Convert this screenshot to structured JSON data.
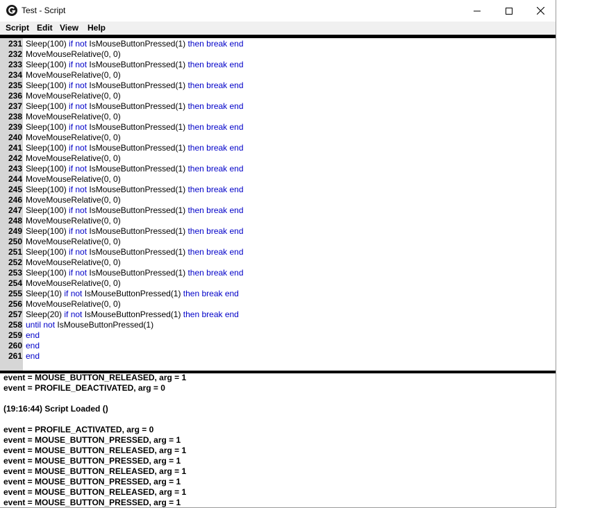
{
  "window": {
    "title": "Test - Script"
  },
  "menu": [
    {
      "label": "Script",
      "name": "menu-script"
    },
    {
      "label": "Edit",
      "name": "menu-edit"
    },
    {
      "label": "View",
      "name": "menu-view"
    },
    {
      "label": "Help",
      "name": "menu-help"
    }
  ],
  "editor": {
    "lines": [
      {
        "n": "231",
        "tokens": [
          [
            "t",
            "Sleep(100) "
          ],
          [
            "k",
            "if not"
          ],
          [
            "t",
            " IsMouseButtonPressed(1) "
          ],
          [
            "k",
            "then break end"
          ]
        ]
      },
      {
        "n": "232",
        "tokens": [
          [
            "t",
            "MoveMouseRelative(0, 0)"
          ]
        ]
      },
      {
        "n": "233",
        "tokens": [
          [
            "t",
            "Sleep(100) "
          ],
          [
            "k",
            "if not"
          ],
          [
            "t",
            " IsMouseButtonPressed(1) "
          ],
          [
            "k",
            "then break end"
          ]
        ]
      },
      {
        "n": "234",
        "tokens": [
          [
            "t",
            "MoveMouseRelative(0, 0)"
          ]
        ]
      },
      {
        "n": "235",
        "tokens": [
          [
            "t",
            "Sleep(100) "
          ],
          [
            "k",
            "if not"
          ],
          [
            "t",
            " IsMouseButtonPressed(1) "
          ],
          [
            "k",
            "then break end"
          ]
        ]
      },
      {
        "n": "236",
        "tokens": [
          [
            "t",
            "MoveMouseRelative(0, 0)"
          ]
        ]
      },
      {
        "n": "237",
        "tokens": [
          [
            "t",
            "Sleep(100) "
          ],
          [
            "k",
            "if not"
          ],
          [
            "t",
            " IsMouseButtonPressed(1) "
          ],
          [
            "k",
            "then break end"
          ]
        ]
      },
      {
        "n": "238",
        "tokens": [
          [
            "t",
            "MoveMouseRelative(0, 0)"
          ]
        ]
      },
      {
        "n": "239",
        "tokens": [
          [
            "t",
            "Sleep(100) "
          ],
          [
            "k",
            "if not"
          ],
          [
            "t",
            " IsMouseButtonPressed(1) "
          ],
          [
            "k",
            "then break end"
          ]
        ]
      },
      {
        "n": "240",
        "tokens": [
          [
            "t",
            "MoveMouseRelative(0, 0)"
          ]
        ]
      },
      {
        "n": "241",
        "tokens": [
          [
            "t",
            "Sleep(100) "
          ],
          [
            "k",
            "if not"
          ],
          [
            "t",
            " IsMouseButtonPressed(1) "
          ],
          [
            "k",
            "then break end"
          ]
        ]
      },
      {
        "n": "242",
        "tokens": [
          [
            "t",
            "MoveMouseRelative(0, 0)"
          ]
        ]
      },
      {
        "n": "243",
        "tokens": [
          [
            "t",
            "Sleep(100) "
          ],
          [
            "k",
            "if not"
          ],
          [
            "t",
            " IsMouseButtonPressed(1) "
          ],
          [
            "k",
            "then break end"
          ]
        ]
      },
      {
        "n": "244",
        "tokens": [
          [
            "t",
            "MoveMouseRelative(0, 0)"
          ]
        ]
      },
      {
        "n": "245",
        "tokens": [
          [
            "t",
            "Sleep(100) "
          ],
          [
            "k",
            "if not"
          ],
          [
            "t",
            " IsMouseButtonPressed(1) "
          ],
          [
            "k",
            "then break end"
          ]
        ]
      },
      {
        "n": "246",
        "tokens": [
          [
            "t",
            "MoveMouseRelative(0, 0)"
          ]
        ]
      },
      {
        "n": "247",
        "tokens": [
          [
            "t",
            "Sleep(100) "
          ],
          [
            "k",
            "if not"
          ],
          [
            "t",
            " IsMouseButtonPressed(1) "
          ],
          [
            "k",
            "then break end"
          ]
        ]
      },
      {
        "n": "248",
        "tokens": [
          [
            "t",
            "MoveMouseRelative(0, 0)"
          ]
        ]
      },
      {
        "n": "249",
        "tokens": [
          [
            "t",
            "Sleep(100) "
          ],
          [
            "k",
            "if not"
          ],
          [
            "t",
            " IsMouseButtonPressed(1) "
          ],
          [
            "k",
            "then break end"
          ]
        ]
      },
      {
        "n": "250",
        "tokens": [
          [
            "t",
            "MoveMouseRelative(0, 0)"
          ]
        ]
      },
      {
        "n": "251",
        "tokens": [
          [
            "t",
            "Sleep(100) "
          ],
          [
            "k",
            "if not"
          ],
          [
            "t",
            " IsMouseButtonPressed(1) "
          ],
          [
            "k",
            "then break end"
          ]
        ]
      },
      {
        "n": "252",
        "tokens": [
          [
            "t",
            "MoveMouseRelative(0, 0)"
          ]
        ]
      },
      {
        "n": "253",
        "tokens": [
          [
            "t",
            "Sleep(100) "
          ],
          [
            "k",
            "if not"
          ],
          [
            "t",
            " IsMouseButtonPressed(1) "
          ],
          [
            "k",
            "then break end"
          ]
        ]
      },
      {
        "n": "254",
        "tokens": [
          [
            "t",
            "MoveMouseRelative(0, 0)"
          ]
        ]
      },
      {
        "n": "255",
        "tokens": [
          [
            "t",
            "Sleep(10) "
          ],
          [
            "k",
            "if not"
          ],
          [
            "t",
            " IsMouseButtonPressed(1) "
          ],
          [
            "k",
            "then break end"
          ]
        ]
      },
      {
        "n": "256",
        "tokens": [
          [
            "t",
            "MoveMouseRelative(0, 0)"
          ]
        ]
      },
      {
        "n": "257",
        "tokens": [
          [
            "t",
            "Sleep(20) "
          ],
          [
            "k",
            "if not"
          ],
          [
            "t",
            " IsMouseButtonPressed(1) "
          ],
          [
            "k",
            "then break end"
          ]
        ]
      },
      {
        "n": "258",
        "tokens": [
          [
            "k",
            "until not"
          ],
          [
            "t",
            " IsMouseButtonPressed(1)"
          ]
        ]
      },
      {
        "n": "259",
        "tokens": [
          [
            "k",
            "end"
          ]
        ]
      },
      {
        "n": "260",
        "tokens": [
          [
            "k",
            "end"
          ]
        ]
      },
      {
        "n": "261",
        "tokens": [
          [
            "k",
            "end"
          ]
        ]
      }
    ]
  },
  "output": {
    "lines": [
      "event = MOUSE_BUTTON_RELEASED, arg = 1",
      "event = PROFILE_DEACTIVATED, arg = 0",
      "",
      "(19:16:44) Script Loaded ()",
      "",
      "event = PROFILE_ACTIVATED, arg = 0",
      "event = MOUSE_BUTTON_PRESSED, arg = 1",
      "event = MOUSE_BUTTON_RELEASED, arg = 1",
      "event = MOUSE_BUTTON_PRESSED, arg = 1",
      "event = MOUSE_BUTTON_RELEASED, arg = 1",
      "event = MOUSE_BUTTON_PRESSED, arg = 1",
      "event = MOUSE_BUTTON_RELEASED, arg = 1",
      "event = MOUSE_BUTTON_PRESSED, arg = 1"
    ]
  },
  "icons": {
    "app": "logitech-g-icon",
    "minimize": "minimize-icon",
    "maximize": "maximize-icon",
    "close": "close-icon"
  },
  "colors": {
    "keyword": "#0000c8",
    "gutter": "#d6d6d6",
    "menubar": "#f0f0f0"
  }
}
